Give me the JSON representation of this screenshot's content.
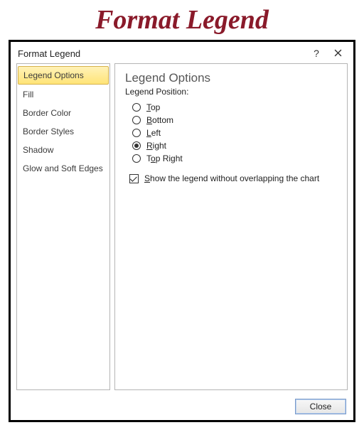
{
  "page_heading": "Format Legend",
  "dialog": {
    "title": "Format Legend",
    "help_symbol": "?",
    "close_button_label": "Close"
  },
  "sidebar": {
    "items": [
      {
        "label": "Legend Options",
        "selected": true
      },
      {
        "label": "Fill",
        "selected": false
      },
      {
        "label": "Border Color",
        "selected": false
      },
      {
        "label": "Border Styles",
        "selected": false
      },
      {
        "label": "Shadow",
        "selected": false
      },
      {
        "label": "Glow and Soft Edges",
        "selected": false
      }
    ]
  },
  "content": {
    "heading": "Legend Options",
    "position_label": "Legend Position:",
    "position_options": [
      {
        "key": "top",
        "label_pre": "",
        "accel": "T",
        "label_post": "op",
        "checked": false
      },
      {
        "key": "bottom",
        "label_pre": "",
        "accel": "B",
        "label_post": "ottom",
        "checked": false
      },
      {
        "key": "left",
        "label_pre": "",
        "accel": "L",
        "label_post": "eft",
        "checked": false
      },
      {
        "key": "right",
        "label_pre": "",
        "accel": "R",
        "label_post": "ight",
        "checked": true
      },
      {
        "key": "topright",
        "label_pre": "T",
        "accel": "o",
        "label_post": "p Right",
        "checked": false
      }
    ],
    "overlap_checkbox": {
      "checked": true,
      "label_pre": "",
      "accel": "S",
      "label_post": "how the legend without overlapping the chart"
    }
  }
}
